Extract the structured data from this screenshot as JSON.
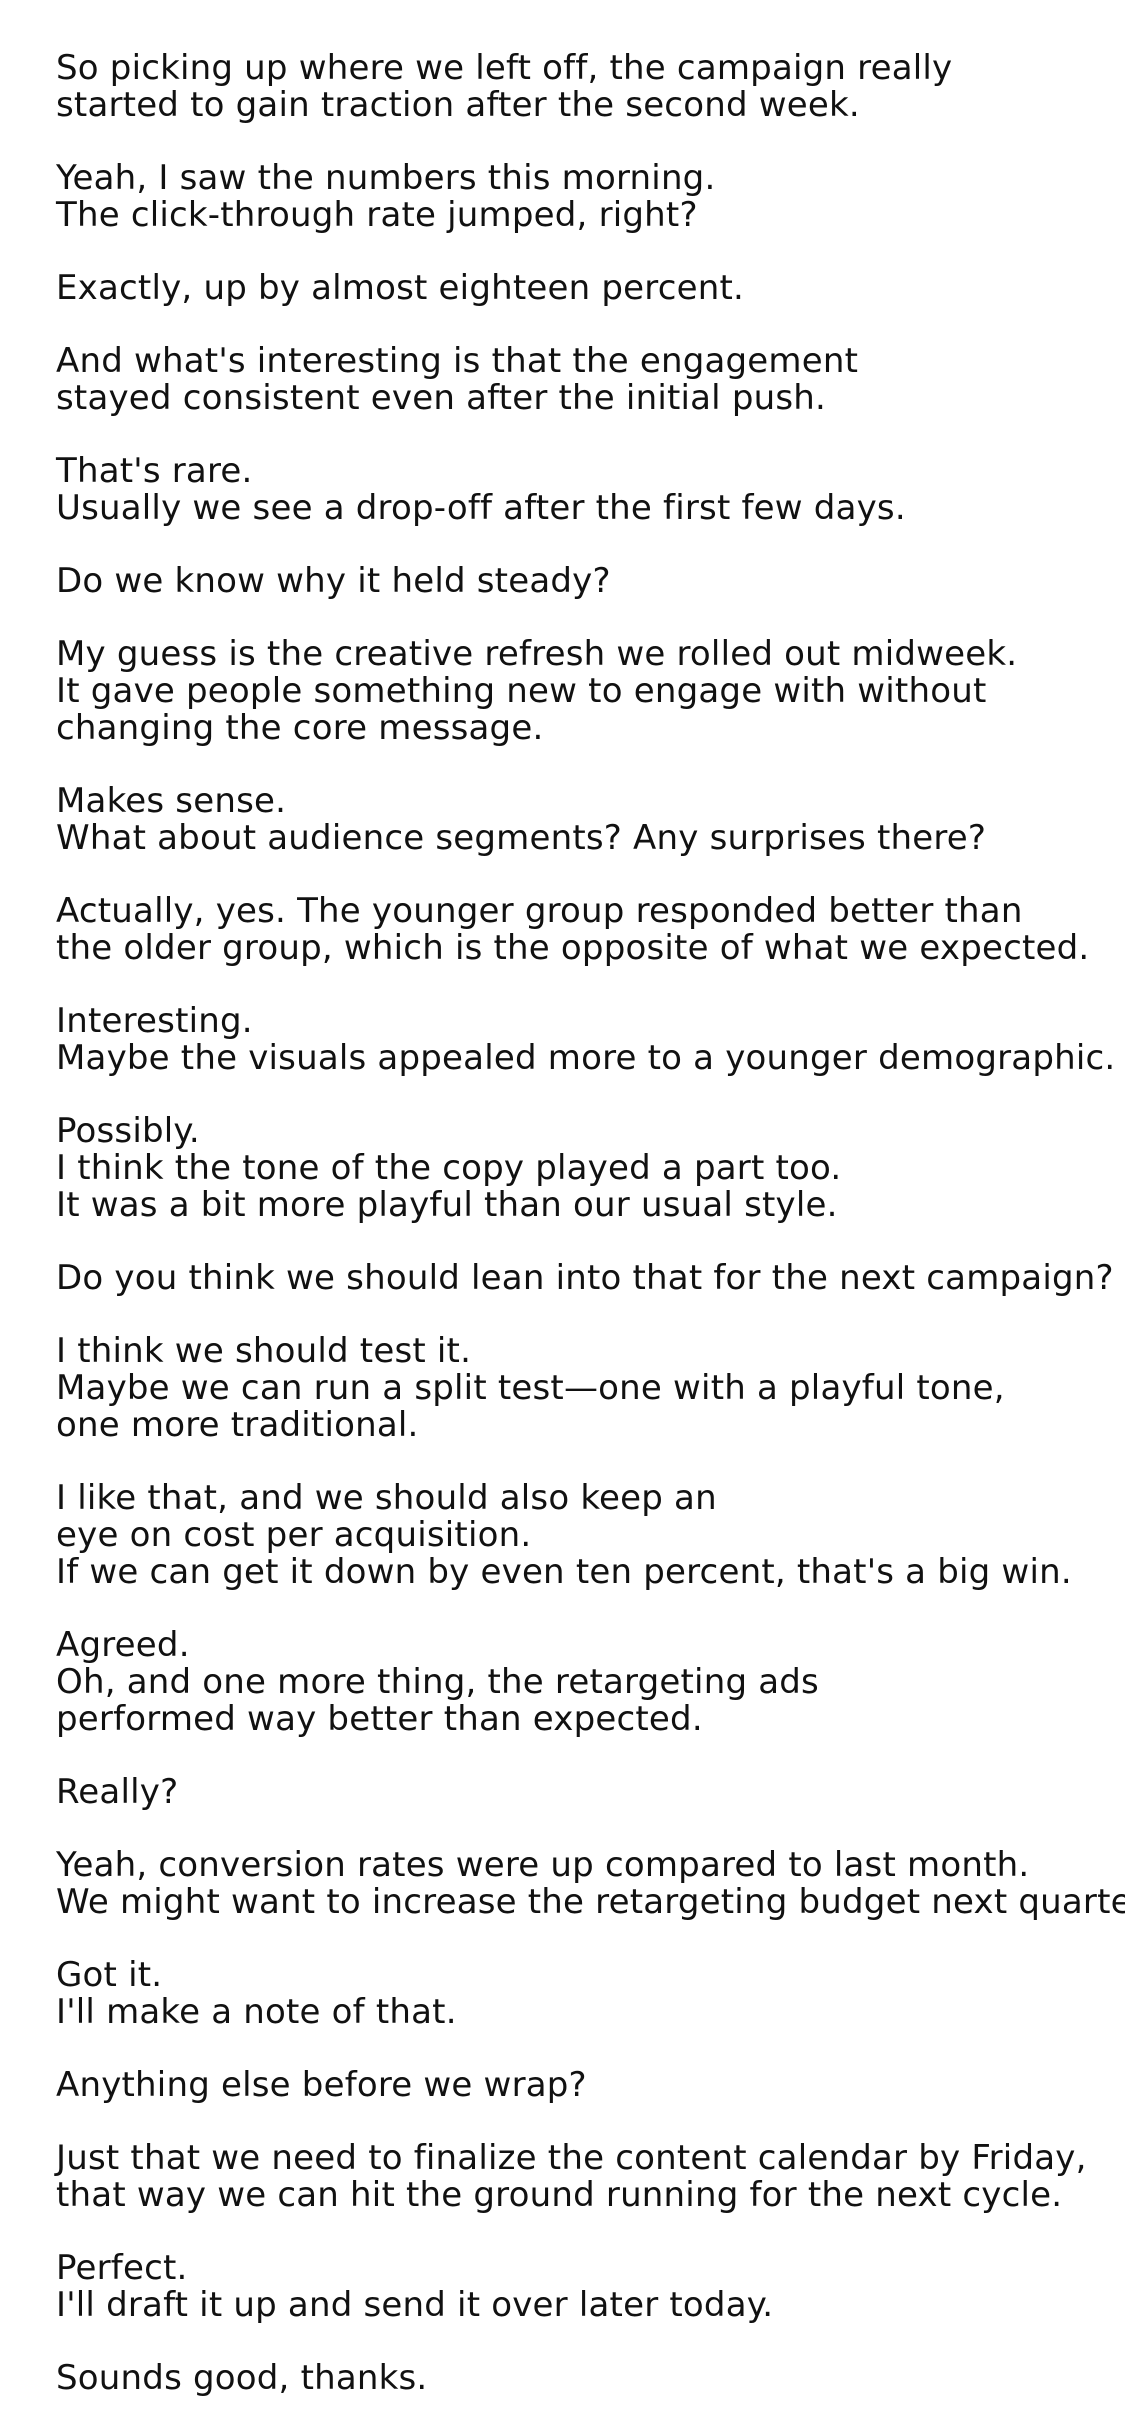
{
  "transcript": {
    "paragraphs": [
      [
        "So picking up where we left off, the campaign really",
        "started to gain traction after the second week."
      ],
      [
        "Yeah, I saw the numbers this morning.",
        "The click-through rate jumped, right?"
      ],
      [
        "Exactly, up by almost eighteen percent."
      ],
      [
        "And what's interesting is that the engagement",
        "stayed consistent even after the initial push."
      ],
      [
        "That's rare.",
        "Usually we see a drop-off after the first few days."
      ],
      [
        "Do we know why it held steady?"
      ],
      [
        "My guess is the creative refresh we rolled out midweek.",
        "It gave people something new to engage with without",
        "changing the core message."
      ],
      [
        "Makes sense.",
        "What about audience segments? Any surprises there?"
      ],
      [
        "Actually, yes. The younger group responded better than",
        "the older group, which is the opposite of what we expected."
      ],
      [
        "Interesting.",
        "Maybe the visuals appealed more to a younger demographic."
      ],
      [
        "Possibly.",
        "I think the tone of the copy played a part too.",
        "It was a bit more playful than our usual style."
      ],
      [
        "Do you think we should lean into that for the next campaign?"
      ],
      [
        "I think we should test it.",
        "Maybe we can run a split test—one with a playful tone,",
        "one more traditional."
      ],
      [
        "I like that, and we should also keep an",
        "eye on cost per acquisition.",
        "If we can get it down by even ten percent, that's a big win."
      ],
      [
        "Agreed.",
        "Oh, and one more thing, the retargeting ads",
        "performed way better than expected."
      ],
      [
        "Really?"
      ],
      [
        "Yeah, conversion rates were up compared to last month.",
        "We might want to increase the retargeting budget next quarter."
      ],
      [
        "Got it.",
        "I'll make a note of that."
      ],
      [
        "Anything else before we wrap?"
      ],
      [
        "Just that we need to finalize the content calendar by Friday,",
        "that way we can hit the ground running for the next cycle."
      ],
      [
        "Perfect.",
        "I'll draft it up and send it over later today."
      ],
      [
        "Sounds good, thanks."
      ]
    ]
  }
}
